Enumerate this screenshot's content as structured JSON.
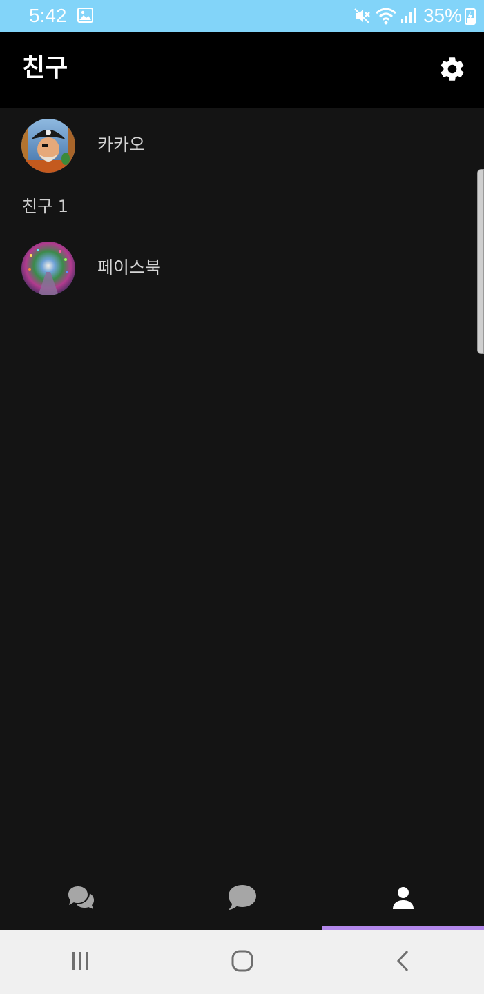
{
  "status_bar": {
    "time": "5:42",
    "battery_text": "35%",
    "icons": [
      "gallery-icon",
      "mute-icon",
      "wifi-icon",
      "signal-icon",
      "battery-icon"
    ],
    "background": "#82d4f9"
  },
  "app_bar": {
    "title": "친구",
    "settings_icon": "gear-icon"
  },
  "friends": {
    "me": {
      "name": "카카오"
    },
    "section_label": "친구 1",
    "items": [
      {
        "name": "페이스북"
      }
    ]
  },
  "tabs": {
    "items": [
      {
        "icon": "chats-icon",
        "active": false
      },
      {
        "icon": "chat-bubble-icon",
        "active": false
      },
      {
        "icon": "person-icon",
        "active": true
      }
    ],
    "accent": "#b388eb"
  },
  "nav_bar": {
    "buttons": [
      "recent-apps-icon",
      "home-icon",
      "back-icon"
    ]
  }
}
